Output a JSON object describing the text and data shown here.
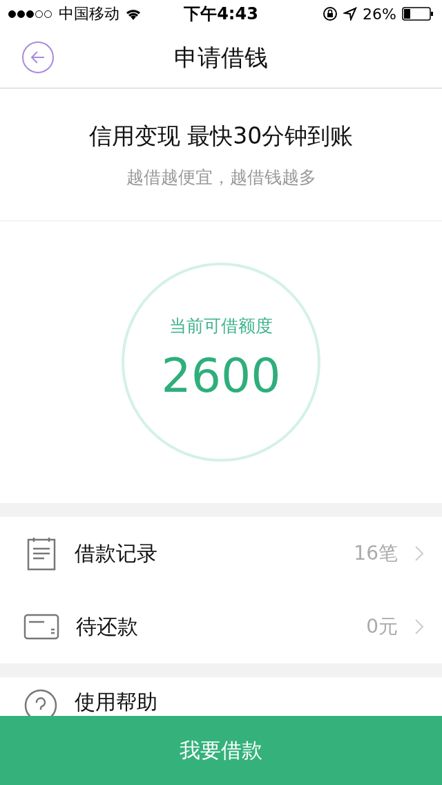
{
  "status_bar": {
    "signal_dots": [
      {
        "filled": true
      },
      {
        "filled": true
      },
      {
        "filled": true
      },
      {
        "filled": false
      },
      {
        "filled": false
      }
    ],
    "carrier": "中国移动",
    "time": "下午4:43",
    "battery": "26%"
  },
  "nav": {
    "title": "申请借钱"
  },
  "header": {
    "title": "信用变现 最快30分钟到账",
    "subtitle": "越借越便宜，越借钱越多"
  },
  "credit": {
    "label": "当前可借额度",
    "amount": "2600"
  },
  "groups": [
    [
      {
        "kind": "record",
        "label": "借款记录",
        "value": "16笔"
      },
      {
        "kind": "card",
        "label": "待还款",
        "value": "0元"
      }
    ],
    [
      {
        "kind": "help",
        "label": "使用帮助"
      }
    ]
  ],
  "action_button": "我要借款"
}
